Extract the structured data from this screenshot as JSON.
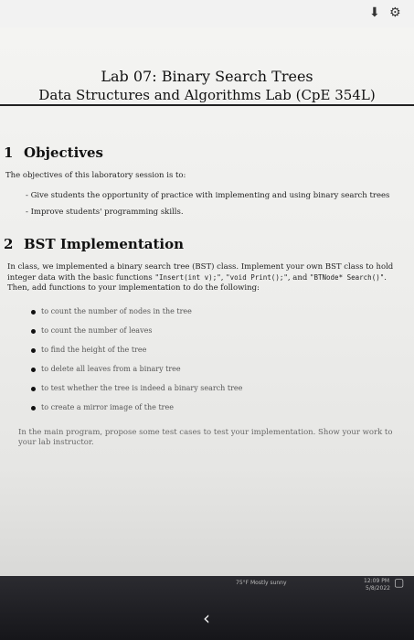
{
  "title": {
    "line1": "Lab 07: Binary Search Trees",
    "line2": "Data Structures and Algorithms Lab (CpE 354L)"
  },
  "section1": {
    "number": "1",
    "heading": "Objectives",
    "intro": "The objectives of this laboratory session is to:",
    "items": [
      "Give students the opportunity of practice with implementing and using binary search trees",
      "Improve students' programming skills."
    ]
  },
  "section2": {
    "number": "2",
    "heading": "BST Implementation",
    "para_part1": "In class, we implemented a binary search tree (BST) class. Implement your own BST class to hold integer data with the basic functions ",
    "code1": "\"Insert(int v);\"",
    "para_part2": ", ",
    "code2": "\"void Print();\"",
    "para_part3": ", and ",
    "code3": "\"BTNode* Search()\"",
    "para_part4": ". Then, add functions to your implementation to do the following:",
    "bullets": [
      "to count the number of nodes in the tree",
      "to count the number of leaves",
      "to find the height of the tree",
      "to delete all leaves from a binary tree",
      "to test whether the tree is indeed a binary search tree",
      "to create a mirror image of the tree"
    ],
    "closing": "In the main program, propose some test cases to test your implementation. Show your work to your lab instructor."
  },
  "taskbar": {
    "weather": "75°F Mostly sunny",
    "time": "12:09 PM",
    "date": "5/8/2022"
  },
  "icons": [
    "download-icon",
    "gear-icon",
    "back-chevron-icon",
    "chat-icon"
  ]
}
